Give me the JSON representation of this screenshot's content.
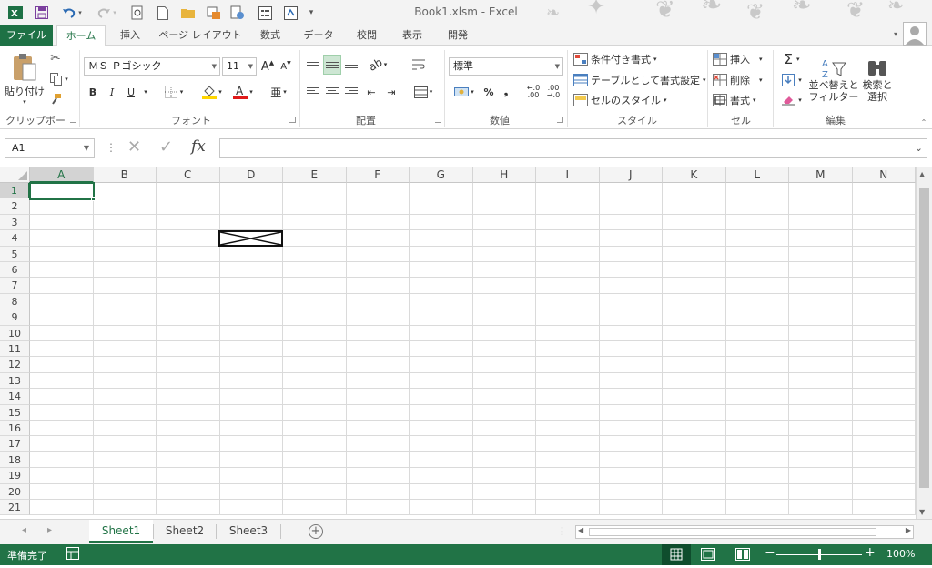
{
  "app": {
    "title": "Book1.xlsm - Excel",
    "accent": "#217346",
    "file_tab_color": "#1e7145"
  },
  "qat": {
    "excel_icon": "excel-logo-icon",
    "undo_icon": "undo-icon",
    "redo_icon": "redo-icon",
    "customize_label": "▾"
  },
  "tabs": [
    "ファイル",
    "ホーム",
    "挿入",
    "ページ レイアウト",
    "数式",
    "データ",
    "校閲",
    "表示",
    "開発"
  ],
  "active_tab": "ホーム",
  "ribbon": {
    "clipboard": {
      "paste_label": "貼り付け",
      "group_label": "クリップボード"
    },
    "font": {
      "font_name": "ＭＳ Ｐゴシック",
      "font_size": "11",
      "bold": "B",
      "italic": "I",
      "underline": "U",
      "grow_label": "A",
      "shrink_label": "A",
      "group_label": "フォント"
    },
    "alignment": {
      "group_label": "配置"
    },
    "number": {
      "format": "標準",
      "percent": "%",
      "comma": "❟",
      "increase_decimal": "←.0\n.00",
      "decrease_decimal": ".00\n→.0",
      "group_label": "数値"
    },
    "styles": {
      "conditional": "条件付き書式",
      "table": "テーブルとして書式設定",
      "cell_styles": "セルのスタイル",
      "group_label": "スタイル"
    },
    "cells": {
      "insert": "挿入",
      "delete": "削除",
      "format": "書式",
      "group_label": "セル"
    },
    "editing": {
      "sort_line1": "並べ替えと",
      "sort_line2": "フィルター",
      "find_line1": "検索と",
      "find_line2": "選択",
      "group_label": "編集"
    }
  },
  "formula_bar": {
    "name_box": "A1",
    "fx_label": "fx",
    "value": ""
  },
  "sheet": {
    "columns": [
      "A",
      "B",
      "C",
      "D",
      "E",
      "F",
      "G",
      "H",
      "I",
      "J",
      "K",
      "L",
      "M",
      "N"
    ],
    "rows": [
      "1",
      "2",
      "3",
      "4",
      "5",
      "6",
      "7",
      "8",
      "9",
      "10",
      "11",
      "12",
      "13",
      "14",
      "15",
      "16",
      "17",
      "18",
      "19",
      "20",
      "21"
    ],
    "selected_cell": "A1",
    "embedded_object_cell": "D4",
    "embedded_object_icon": "crossed-box-object-icon"
  },
  "sheets": [
    "Sheet1",
    "Sheet2",
    "Sheet3"
  ],
  "active_sheet": "Sheet1",
  "status": {
    "ready": "準備完了",
    "zoom": "100%",
    "zoom_level": 1.0
  }
}
